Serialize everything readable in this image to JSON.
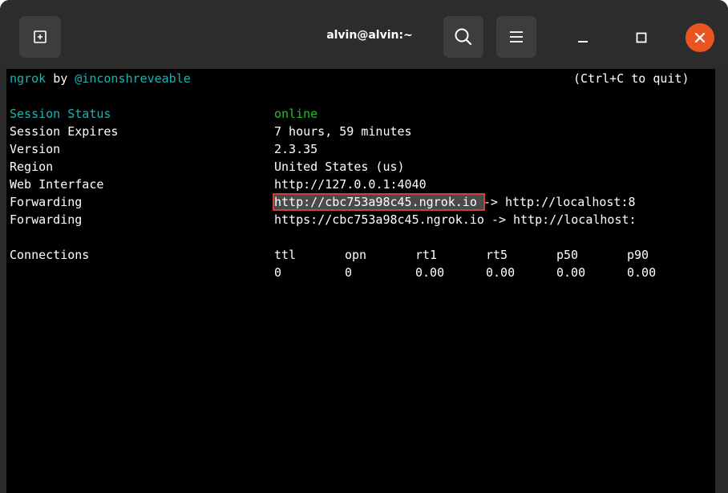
{
  "window": {
    "title": "alvin@alvin:~",
    "close_color": "#e95420",
    "icons": {
      "new_tab": "new-tab-icon",
      "search": "search-icon",
      "menu": "hamburger-menu-icon",
      "minimize": "minimize-icon",
      "maximize": "maximize-icon",
      "close": "close-icon"
    }
  },
  "terminal": {
    "header": {
      "app": "ngrok",
      "by": "by",
      "author": "@inconshreveable",
      "quit_hint": "(Ctrl+C to quit)"
    },
    "rows": [
      {
        "label": "Session Status",
        "value": "online"
      },
      {
        "label": "Session Expires",
        "value": "7 hours, 59 minutes"
      },
      {
        "label": "Version",
        "value": "2.3.35"
      },
      {
        "label": "Region",
        "value": "United States (us)"
      },
      {
        "label": "Web Interface",
        "value": "http://127.0.0.1:4040"
      },
      {
        "label": "Forwarding",
        "value_highlight": "http://cbc753a98c45.ngrok.io",
        "value_rest": "-> http://localhost:8"
      },
      {
        "label": "Forwarding",
        "value": "https://cbc753a98c45.ngrok.io -> http://localhost:"
      }
    ],
    "connections": {
      "label": "Connections",
      "headers": [
        "ttl",
        "opn",
        "rt1",
        "rt5",
        "p50",
        "p90"
      ],
      "values": [
        "0",
        "0",
        "0.00",
        "0.00",
        "0.00",
        "0.00"
      ]
    }
  }
}
